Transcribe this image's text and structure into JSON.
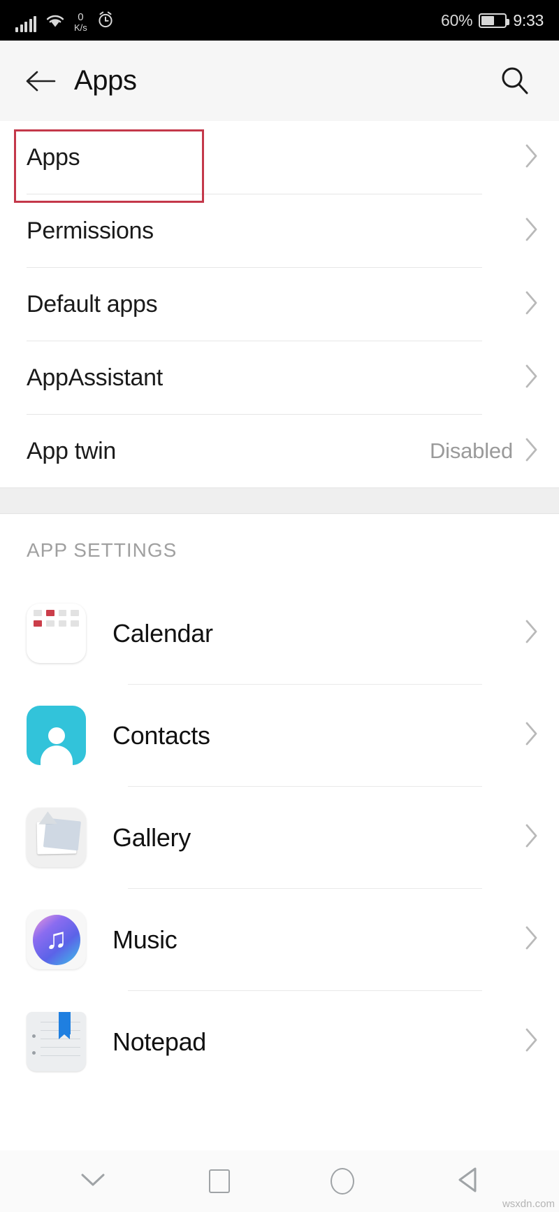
{
  "statusbar": {
    "network_speed_value": "0",
    "network_speed_unit": "K/s",
    "battery_percent": "60%",
    "time": "9:33",
    "icons": [
      "signal-bars-icon",
      "wifi-icon",
      "alarm-clock-icon",
      "battery-icon"
    ]
  },
  "header": {
    "title": "Apps",
    "back_icon": "back-arrow-icon",
    "search_icon": "search-icon"
  },
  "settings_rows": [
    {
      "label": "Apps",
      "value": "",
      "highlighted": true
    },
    {
      "label": "Permissions",
      "value": "",
      "highlighted": false
    },
    {
      "label": "Default apps",
      "value": "",
      "highlighted": false
    },
    {
      "label": "AppAssistant",
      "value": "",
      "highlighted": false
    },
    {
      "label": "App twin",
      "value": "Disabled",
      "highlighted": false
    }
  ],
  "app_settings": {
    "section_title": "APP SETTINGS",
    "apps": [
      {
        "name": "Calendar",
        "icon": "calendar-app-icon"
      },
      {
        "name": "Contacts",
        "icon": "contacts-app-icon"
      },
      {
        "name": "Gallery",
        "icon": "gallery-app-icon"
      },
      {
        "name": "Music",
        "icon": "music-app-icon"
      },
      {
        "name": "Notepad",
        "icon": "notepad-app-icon"
      }
    ]
  },
  "navbar": {
    "items": [
      "chevron-down-icon",
      "recents-square-icon",
      "home-circle-icon",
      "back-triangle-icon"
    ]
  },
  "watermark": "wsxdn.com",
  "colors": {
    "highlight_border": "#c4384a",
    "header_bg": "#f6f6f6",
    "value_text": "#9a9a9a",
    "calendar_red": "#cb3e4a",
    "contacts_teal": "#32c3da",
    "notepad_blue": "#1f7fe0"
  }
}
